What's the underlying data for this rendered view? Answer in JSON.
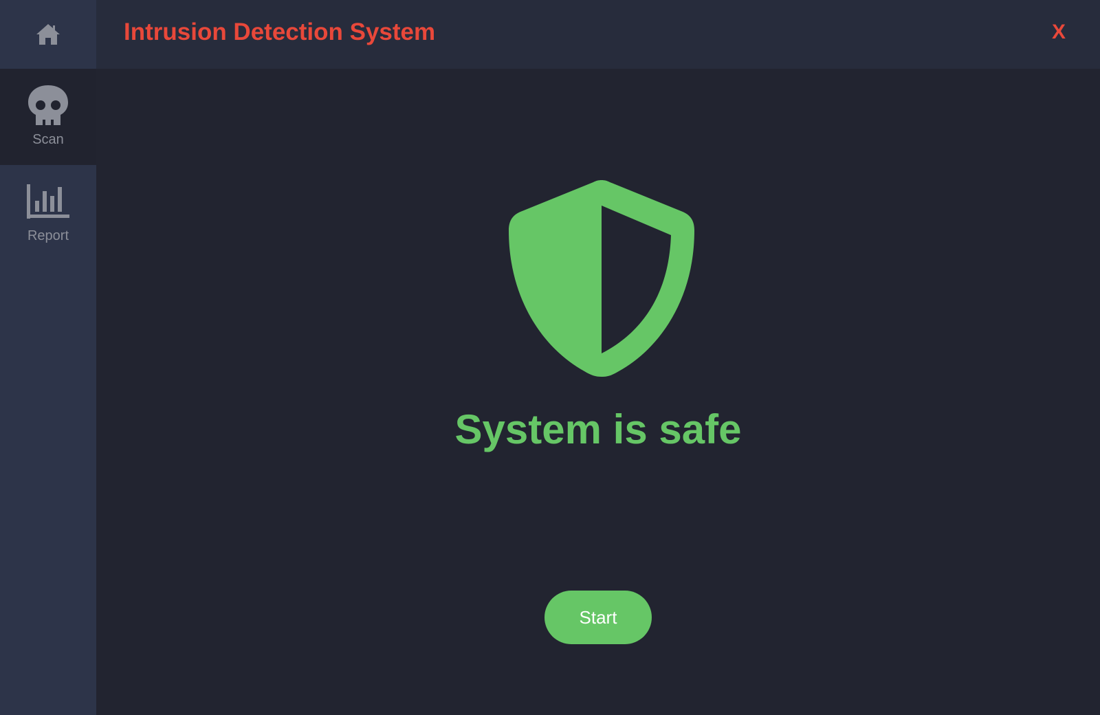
{
  "app": {
    "title": "Intrusion Detection System",
    "close_label": "X",
    "accent_color": "#e8483a",
    "safe_color": "#66c666"
  },
  "sidebar": {
    "home_icon": "home-icon",
    "items": [
      {
        "label": "Scan",
        "icon": "skull-icon",
        "active": true
      },
      {
        "label": "Report",
        "icon": "bar-chart-icon",
        "active": false
      }
    ]
  },
  "main": {
    "status_icon": "shield-icon",
    "status_text": "System is safe",
    "start_label": "Start"
  }
}
